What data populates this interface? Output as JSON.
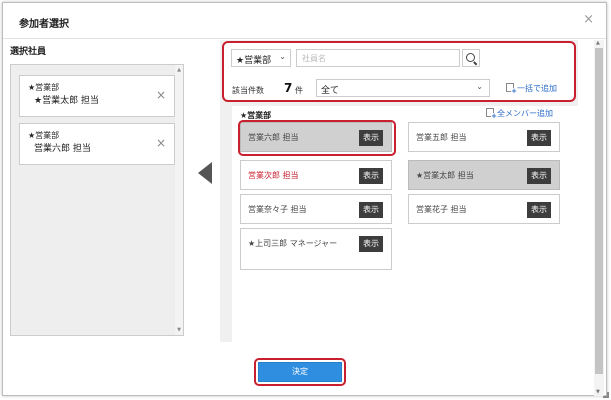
{
  "dialog": {
    "title": "参加者選択",
    "close_icon": "×"
  },
  "left": {
    "label": "選択社員",
    "selected": [
      {
        "dept": "★営業部",
        "name": "★営業太郎 担当",
        "remove": "×"
      },
      {
        "dept": "★営業部",
        "name": "営業六郎 担当",
        "remove": "×"
      }
    ]
  },
  "filter": {
    "dept_value": "★営業部",
    "dept_chevron": "⌄",
    "name_placeholder": "社員名",
    "count_label": "該当件数",
    "count_value": "7",
    "count_unit": "件",
    "scope_value": "全て",
    "scope_chevron": "⌄",
    "bulk_add_label": "一括で追加"
  },
  "list": {
    "group_name": "★営業部",
    "all_add_label": "全メンバー追加",
    "show_label": "表示",
    "members": [
      {
        "name": "営業六郎 担当"
      },
      {
        "name": "営業五郎 担当"
      },
      {
        "name": "営業次郎 担当"
      },
      {
        "name": "★営業太郎 担当"
      },
      {
        "name": "営業奈々子 担当"
      },
      {
        "name": "営業花子 担当"
      },
      {
        "name": "★上司三郎 マネージャー"
      }
    ]
  },
  "footer": {
    "decide_label": "決定"
  },
  "colors": {
    "highlight_red": "#c8202f",
    "link_blue": "#2a6cc8",
    "primary_blue": "#2f8ee0"
  }
}
